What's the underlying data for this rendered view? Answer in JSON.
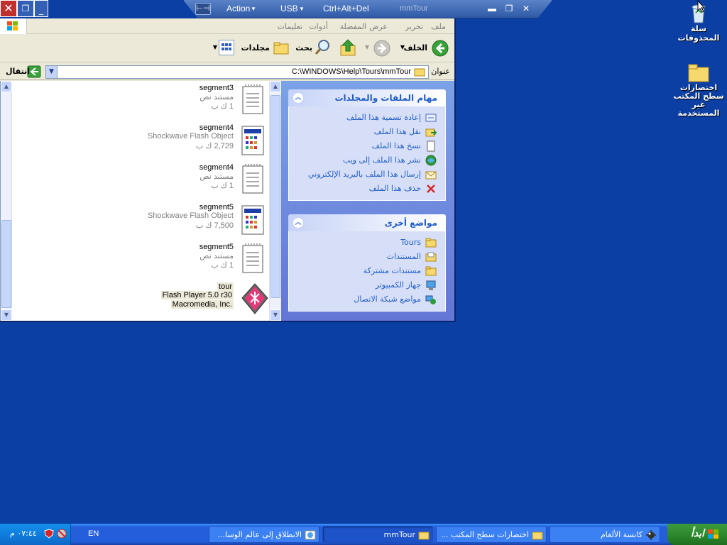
{
  "vm_toolbar": {
    "menus": [
      "Action",
      "USB",
      "Ctrl+Alt+Del"
    ],
    "title": "mmTour"
  },
  "menubar": [
    "ملف",
    "تحرير",
    "عرض",
    "المفضلة",
    "أدوات",
    "تعليمات"
  ],
  "toolbar": {
    "back": "الخلف",
    "search": "بحث",
    "folders": "مجلدات"
  },
  "address": {
    "label": "عنوان",
    "path": "C:\\WINDOWS\\Help\\Tours\\mmTour",
    "go": "انتقال"
  },
  "file_tasks": {
    "title": "مهام الملفات والمجلدات",
    "items": [
      {
        "label": "إعادة تسمية هذا الملف",
        "icon": "rename-icon"
      },
      {
        "label": "نقل هذا الملف",
        "icon": "move-icon"
      },
      {
        "label": "نسخ هذا الملف",
        "icon": "copy-icon"
      },
      {
        "label": "نشر هذا الملف إلى ويب",
        "icon": "publish-web-icon"
      },
      {
        "label": "إرسال هذا الملف بالبريد الإلكتروني",
        "icon": "email-icon"
      },
      {
        "label": "حذف هذا الملف",
        "icon": "delete-icon"
      }
    ]
  },
  "other_places": {
    "title": "مواضع أخرى",
    "items": [
      {
        "label": "Tours",
        "icon": "folder-icon"
      },
      {
        "label": "المستندات",
        "icon": "documents-icon"
      },
      {
        "label": "مستندات مشتركة",
        "icon": "shared-documents-icon"
      },
      {
        "label": "جهاز الكمبيوتر",
        "icon": "computer-icon"
      },
      {
        "label": "مواضع شبكة الاتصال",
        "icon": "network-icon"
      }
    ]
  },
  "files": [
    {
      "name": "segment3",
      "desc": "مستند نص",
      "size": "1 ك ب",
      "type": "text"
    },
    {
      "name": "segment4",
      "desc": "Shockwave Flash Object",
      "size": "2,729 ك ب",
      "type": "flash"
    },
    {
      "name": "segment4",
      "desc": "مستند نص",
      "size": "1 ك ب",
      "type": "text"
    },
    {
      "name": "segment5",
      "desc": "Shockwave Flash Object",
      "size": "7,500 ك ب",
      "type": "flash"
    },
    {
      "name": "segment5",
      "desc": "مستند نص",
      "size": "1 ك ب",
      "type": "text"
    },
    {
      "name": "tour",
      "desc": "Flash Player 5.0 r30",
      "size": "Macromedia, Inc.",
      "type": "player"
    }
  ],
  "desktop_icons": [
    {
      "label": "سلة المحذوفات",
      "icon": "recycle-bin-icon"
    },
    {
      "label": "اختصارات سطح المكتب غير المستخدمة",
      "icon": "folder-icon"
    }
  ],
  "taskbar": {
    "start": "ابدأ",
    "tasks": [
      {
        "label": "كانسة الألغام",
        "icon": "minesweeper-icon"
      },
      {
        "label": "اختصارات سطح المكتب ...",
        "icon": "folder-icon"
      },
      {
        "label": "mmTour",
        "icon": "folder-icon"
      },
      {
        "label": "الانطلاق إلى عالم الوسا...",
        "icon": "tour-icon"
      }
    ],
    "lang": "EN",
    "clock": "٠٧:٤٤ م"
  },
  "colors": {
    "desktop": "#0b3fa3",
    "task_link": "#215dc6",
    "taskbar": "#245edb",
    "start": "#2f8a2f"
  }
}
